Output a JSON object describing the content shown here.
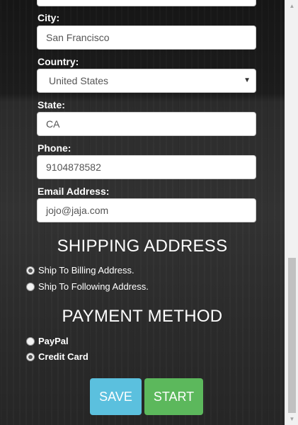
{
  "form": {
    "city": {
      "label": "City:",
      "value": "San Francisco"
    },
    "country": {
      "label": "Country:",
      "value": "United States"
    },
    "state": {
      "label": "State:",
      "value": "CA"
    },
    "phone": {
      "label": "Phone:",
      "value": "9104878582"
    },
    "email": {
      "label": "Email Address:",
      "value": "jojo@jaja.com"
    }
  },
  "shipping": {
    "title": "SHIPPING ADDRESS",
    "options": [
      {
        "label": "Ship To Billing Address.",
        "checked": true
      },
      {
        "label": "Ship To Following Address.",
        "checked": false
      }
    ]
  },
  "payment": {
    "title": "PAYMENT METHOD",
    "options": [
      {
        "label": "PayPal",
        "checked": false
      },
      {
        "label": "Credit Card",
        "checked": true
      }
    ]
  },
  "buttons": {
    "save": "SAVE",
    "start": "START"
  },
  "icons": {
    "select_arrow": "caret-down-icon",
    "scroll_up": "triangle-up-icon",
    "scroll_down": "triangle-down-icon"
  },
  "colors": {
    "save": "#5bc0de",
    "start": "#5cb85c"
  }
}
